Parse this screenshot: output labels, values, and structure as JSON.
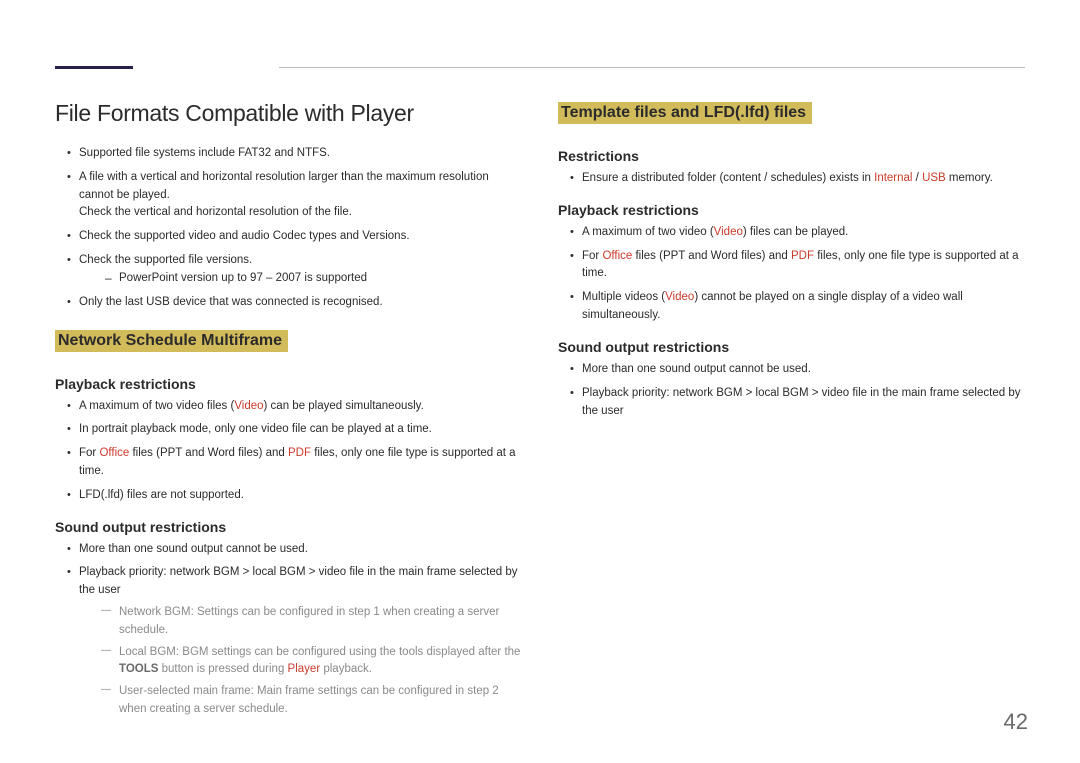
{
  "page_number": "42",
  "left": {
    "title": "File Formats Compatible with Player",
    "intro": {
      "b1": "Supported file systems include FAT32 and NTFS.",
      "b2": "A file with a vertical and horizontal resolution larger than the maximum resolution cannot be played.",
      "b2_extra": "Check the vertical and horizontal resolution of the file.",
      "b3": "Check the supported video and audio Codec types and Versions.",
      "b4": "Check the supported file versions.",
      "b4_d1": "PowerPoint version up to 97 – 2007 is supported",
      "b5": "Only the last USB device that was connected is recognised."
    },
    "hl_heading": "Network Schedule Multiframe",
    "playback": {
      "heading": "Playback restrictions",
      "i1_pre": "A maximum of two video files (",
      "i1_red": "Video",
      "i1_post": ") can be played simultaneously.",
      "i2": "In portrait playback mode, only one video file can be played at a time.",
      "i3_pre": "For ",
      "i3_red1": "Office",
      "i3_mid": " files (PPT and Word files) and ",
      "i3_red2": "PDF",
      "i3_post": " files, only one file type is supported at a time.",
      "i4": "LFD(.lfd) files are not supported."
    },
    "sound": {
      "heading": "Sound output restrictions",
      "i1": "More than one sound output cannot be used.",
      "i2": "Playback priority: network BGM > local BGM > video file in the main frame selected by the user",
      "d1": "Network BGM: Settings can be configured in step 1 when creating a server schedule.",
      "d2_pre": "Local BGM: BGM settings can be configured using the tools displayed after the ",
      "d2_tools": "TOOLS",
      "d2_mid": " button is pressed during ",
      "d2_red": "Player",
      "d2_post": " playback.",
      "d3": "User-selected main frame: Main frame settings can be configured in step 2 when creating a server schedule."
    }
  },
  "right": {
    "hl_heading": "Template files and LFD(.lfd) files",
    "restrictions": {
      "heading": "Restrictions",
      "i1_pre": "Ensure a distributed folder (content / schedules) exists in ",
      "i1_red1": "Internal",
      "i1_slash": " / ",
      "i1_red2": "USB",
      "i1_post": " memory."
    },
    "playback": {
      "heading": "Playback restrictions",
      "i1_pre": "A maximum of two video (",
      "i1_red": "Video",
      "i1_post": ") files can be played.",
      "i2_pre": "For ",
      "i2_red1": "Office",
      "i2_mid": " files (PPT and Word files) and ",
      "i2_red2": "PDF",
      "i2_post": " files, only one file type is supported at a time.",
      "i3_pre": "Multiple videos (",
      "i3_red": "Video",
      "i3_post": ") cannot be played on a single display of a video wall simultaneously."
    },
    "sound": {
      "heading": "Sound output restrictions",
      "i1": "More than one sound output cannot be used.",
      "i2": "Playback priority: network BGM > local BGM > video file in the main frame selected by the user"
    }
  }
}
